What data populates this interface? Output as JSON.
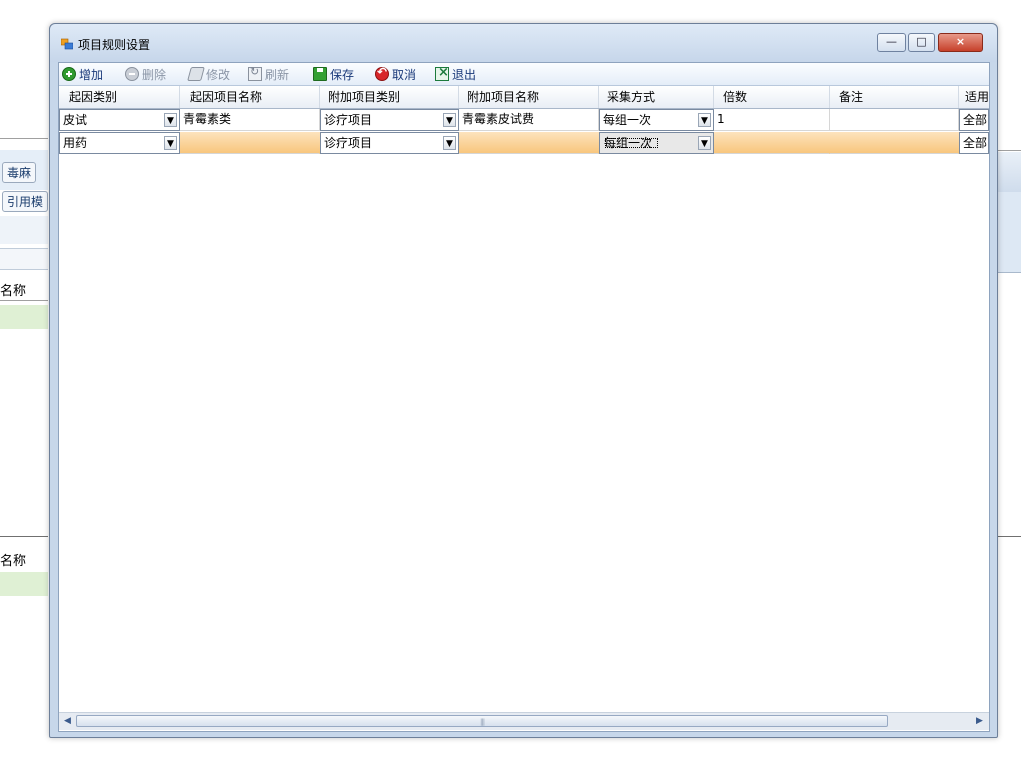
{
  "background": {
    "chip_dupo": "毒麻",
    "chip_template": "引用模",
    "col_name_1": "名称",
    "col_name_2": "名称"
  },
  "dialog": {
    "title": "项目规则设置",
    "window_buttons": {
      "minimize": "—",
      "maximize": "□",
      "close": "×"
    }
  },
  "toolbar": {
    "add": "增加",
    "delete": "删除",
    "edit": "修改",
    "refresh": "刷新",
    "save": "保存",
    "cancel": "取消",
    "exit": "退出"
  },
  "grid": {
    "columns": [
      "起因类别",
      "起因项目名称",
      "附加项目类别",
      "附加项目名称",
      "采集方式",
      "倍数",
      "备注",
      "适用"
    ],
    "rows": [
      {
        "cause_type": "皮试",
        "cause_item": "青霉素类",
        "extra_type": "诊疗项目",
        "extra_item": "青霉素皮试费",
        "collect": "每组一次",
        "multiple": "1",
        "note": "",
        "apply": "全部"
      },
      {
        "cause_type": "用药",
        "cause_item": "",
        "extra_type": "诊疗项目",
        "extra_item": "",
        "collect": "每组一次",
        "multiple": "",
        "note": "",
        "apply": "全部"
      }
    ]
  },
  "scrollbar": {
    "left": "◀",
    "right": "▶",
    "grip": "|||"
  },
  "colors": {
    "selected_row": "#f8c57a",
    "title_bar": "#c6d6ea"
  }
}
